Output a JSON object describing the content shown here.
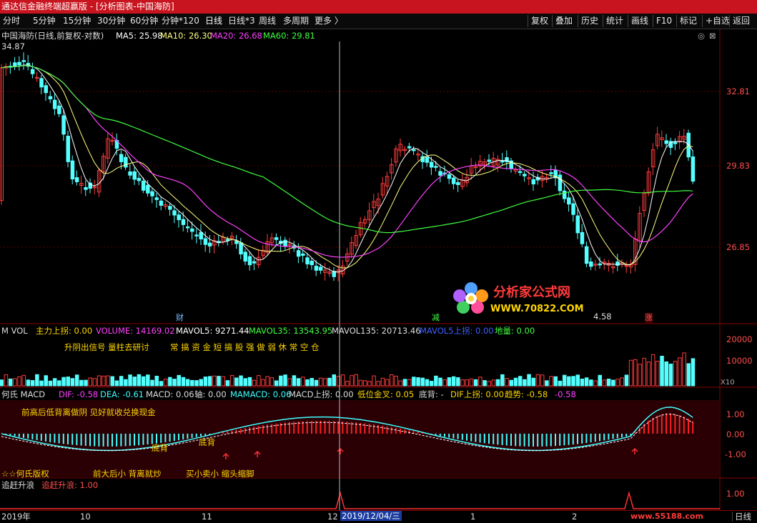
{
  "window": {
    "title": "通达信金融终端超赢版 - [分析图表-中国海防]"
  },
  "toolbar": {
    "timeframes": [
      "分时",
      "5分钟",
      "15分钟",
      "30分钟",
      "60分钟",
      "分钟*120",
      "日线",
      "日线*3",
      "周线",
      "多周期",
      "更多 〉"
    ],
    "right_buttons": [
      "复权",
      "叠加",
      "历史",
      "统计",
      "画线",
      "F10",
      "标记",
      "+自选",
      "返回"
    ]
  },
  "main_chart": {
    "legend_name": "中国海防(日线,前复权-对数)",
    "ma5": "MA5: 25.98",
    "ma10": "MA10: 26.30",
    "ma20": "MA20: 26.68",
    "ma60": "MA60: 29.81",
    "high_label": "34.87",
    "low_label": "4.58",
    "price_ticks": [
      "32.81",
      "29.83",
      "26.85"
    ],
    "markers": {
      "cai": "财",
      "jian": "减",
      "zhang": "涨"
    },
    "colors": {
      "up": "#ff3b3b",
      "down": "#54ffff",
      "ma5": "#ffffff",
      "ma10": "#ffff80",
      "ma20": "#ff40ff",
      "ma60": "#40ff40"
    }
  },
  "watermark": {
    "brand": "分析家公式网",
    "url": "WWW.70822.COM"
  },
  "volume_panel": {
    "prefix": "M VOL",
    "main_up": "主力上拐: 0.00",
    "volume": "VOLUME: 14169.02",
    "mavol5": "MAVOL5: 9271.44",
    "mavol35": "MAVOL35: 13543.95",
    "mavol135": "MAVOL135: 20713.46",
    "mavol5_up": "MAVOL5上拐: 0.00",
    "ground": "地量: 0.00",
    "note_left": "升阴出信号  量柱去研讨",
    "note_right": "常 搞 资 金 短 搞 股 强 做 弱 休 常 空 仓",
    "ticks": [
      "20000",
      "10000"
    ],
    "x_label": "X10"
  },
  "macd_panel": {
    "name": "何氏 MACD",
    "dif": "DIF: -0.58",
    "dea": "DEA: -0.61",
    "macd": "MACD: 0.06",
    "axis": "轴: 0.00",
    "mamacd": "MAMACD: 0.06",
    "macd_up": "MACD上拐: 0.00",
    "low_gold": "低位金叉: 0.05",
    "bottom_div": "底背: -",
    "dif_up": "DIF上拐: 0.00",
    "trend": "趋势: -0.58",
    "trend_val2": "-0.58",
    "note1": "前高后低背离做阴  见好就收兑换现金",
    "bd1": "底背",
    "bd2": "底背",
    "copyright": "☆☆何氏版权",
    "note2": "前大后小  背离就炒",
    "note3": "买小卖小  缩头缩脚",
    "ticks": [
      "1.00",
      "0.00",
      "-1.00"
    ]
  },
  "chase_panel": {
    "name": "追赶升浪",
    "value": "追赶升浪: 1.00",
    "tick": "1.00"
  },
  "date_axis": {
    "labels": [
      "2019年",
      "10",
      "11",
      "12",
      "1",
      "2"
    ],
    "crosshair_date": "2019/12/04/三",
    "period_button": "日线"
  },
  "footer_watermark": "www.55188.com"
}
